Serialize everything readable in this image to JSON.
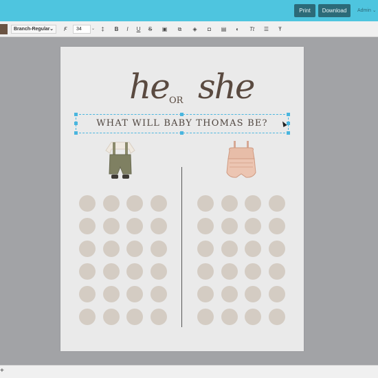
{
  "topbar": {
    "print_label": "Print",
    "download_label": "Download",
    "admin_label": "Admin ⌄"
  },
  "toolbar": {
    "color_swatch": "#6b5443",
    "font_family": "Branch-Regular",
    "font_size": "34",
    "icons": [
      "font-style-icon",
      "line-spacing-icon",
      "bold-icon",
      "italic-icon",
      "underline-icon",
      "strikethrough-icon",
      "image-icon",
      "duplicate-icon",
      "layers-icon",
      "arrange-icon",
      "lock-icon",
      "color-fill-icon",
      "text-transform-icon",
      "list-icon",
      "clear-format-icon"
    ]
  },
  "canvas": {
    "title_left": "he",
    "title_connector": "OR",
    "title_right": "she",
    "subtitle": "WHAT WILL BABY THOMAS BE?",
    "left_outfit": "boy-overalls-outfit",
    "right_outfit": "girl-romper-outfit",
    "left_circles": 24,
    "right_circles": 24,
    "circle_color": "#d4ccc3"
  },
  "bottombar": {
    "add_label": "+"
  }
}
